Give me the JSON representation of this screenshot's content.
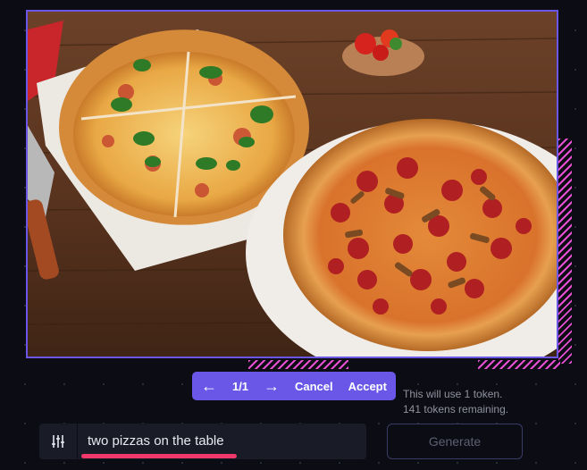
{
  "canvas": {
    "image_description_icon": "pizza-photo"
  },
  "toolbar": {
    "prev_icon": "←",
    "page_indicator": "1/1",
    "next_icon": "→",
    "cancel_label": "Cancel",
    "accept_label": "Accept"
  },
  "info": {
    "line1": "This will use 1 token.",
    "line2": "141 tokens remaining."
  },
  "prompt": {
    "value": "two pizzas on the table"
  },
  "generate": {
    "label": "Generate"
  },
  "colors": {
    "accent": "#6a57e8",
    "underline": "#f0386b",
    "hatch": "#e64fd1",
    "background": "#0c0d14"
  }
}
